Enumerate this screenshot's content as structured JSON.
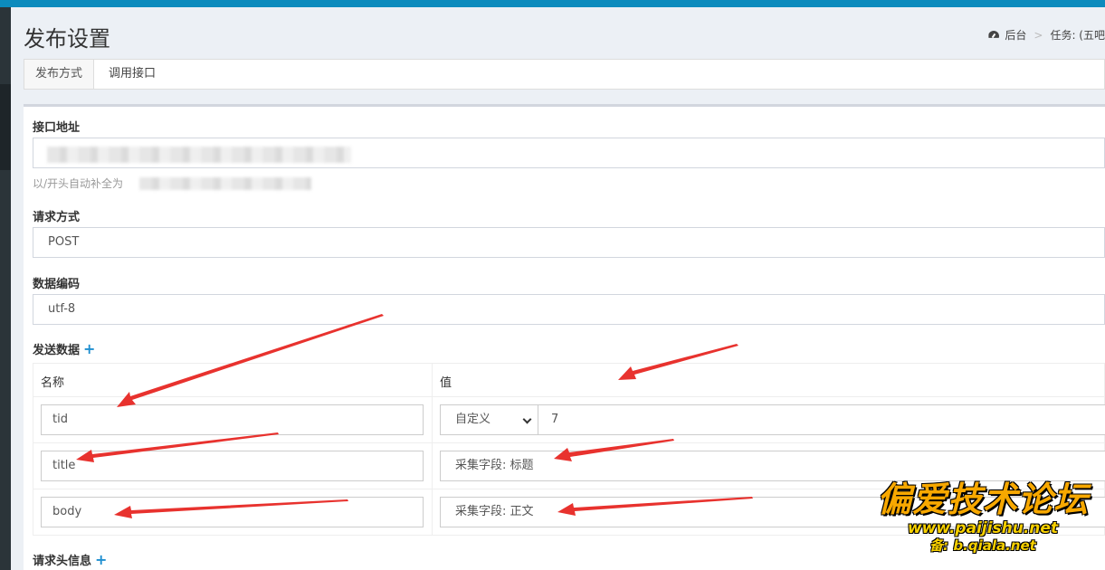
{
  "page": {
    "title": "发布设置"
  },
  "breadcrumb": {
    "home": "后台",
    "separator": ">",
    "current": "任务: (五吧"
  },
  "tabs": [
    {
      "label": "发布方式"
    },
    {
      "label": "调用接口"
    }
  ],
  "form": {
    "api_url": {
      "label": "接口地址",
      "value": "",
      "help": "以/开头自动补全为"
    },
    "method": {
      "label": "请求方式",
      "value": "POST"
    },
    "encoding": {
      "label": "数据编码",
      "value": "utf-8"
    },
    "send_data": {
      "label": "发送数据",
      "add_symbol": "+",
      "columns": {
        "name": "名称",
        "value": "值"
      },
      "rows": [
        {
          "name": "tid",
          "type": "自定义",
          "value": "7"
        },
        {
          "name": "title",
          "value": "采集字段: 标题"
        },
        {
          "name": "body",
          "value": "采集字段: 正文"
        }
      ]
    },
    "headers": {
      "label": "请求头信息",
      "add_symbol": "+"
    }
  },
  "watermark": {
    "title": "偏爱技术论坛",
    "url": "www.paijishu.net",
    "backup": "备: b.qiala.net"
  },
  "colors": {
    "topbar": "#0c8bbd",
    "accent": "#1f8fd0",
    "arrow": "#e8322e",
    "watermark": "#f7a800"
  }
}
